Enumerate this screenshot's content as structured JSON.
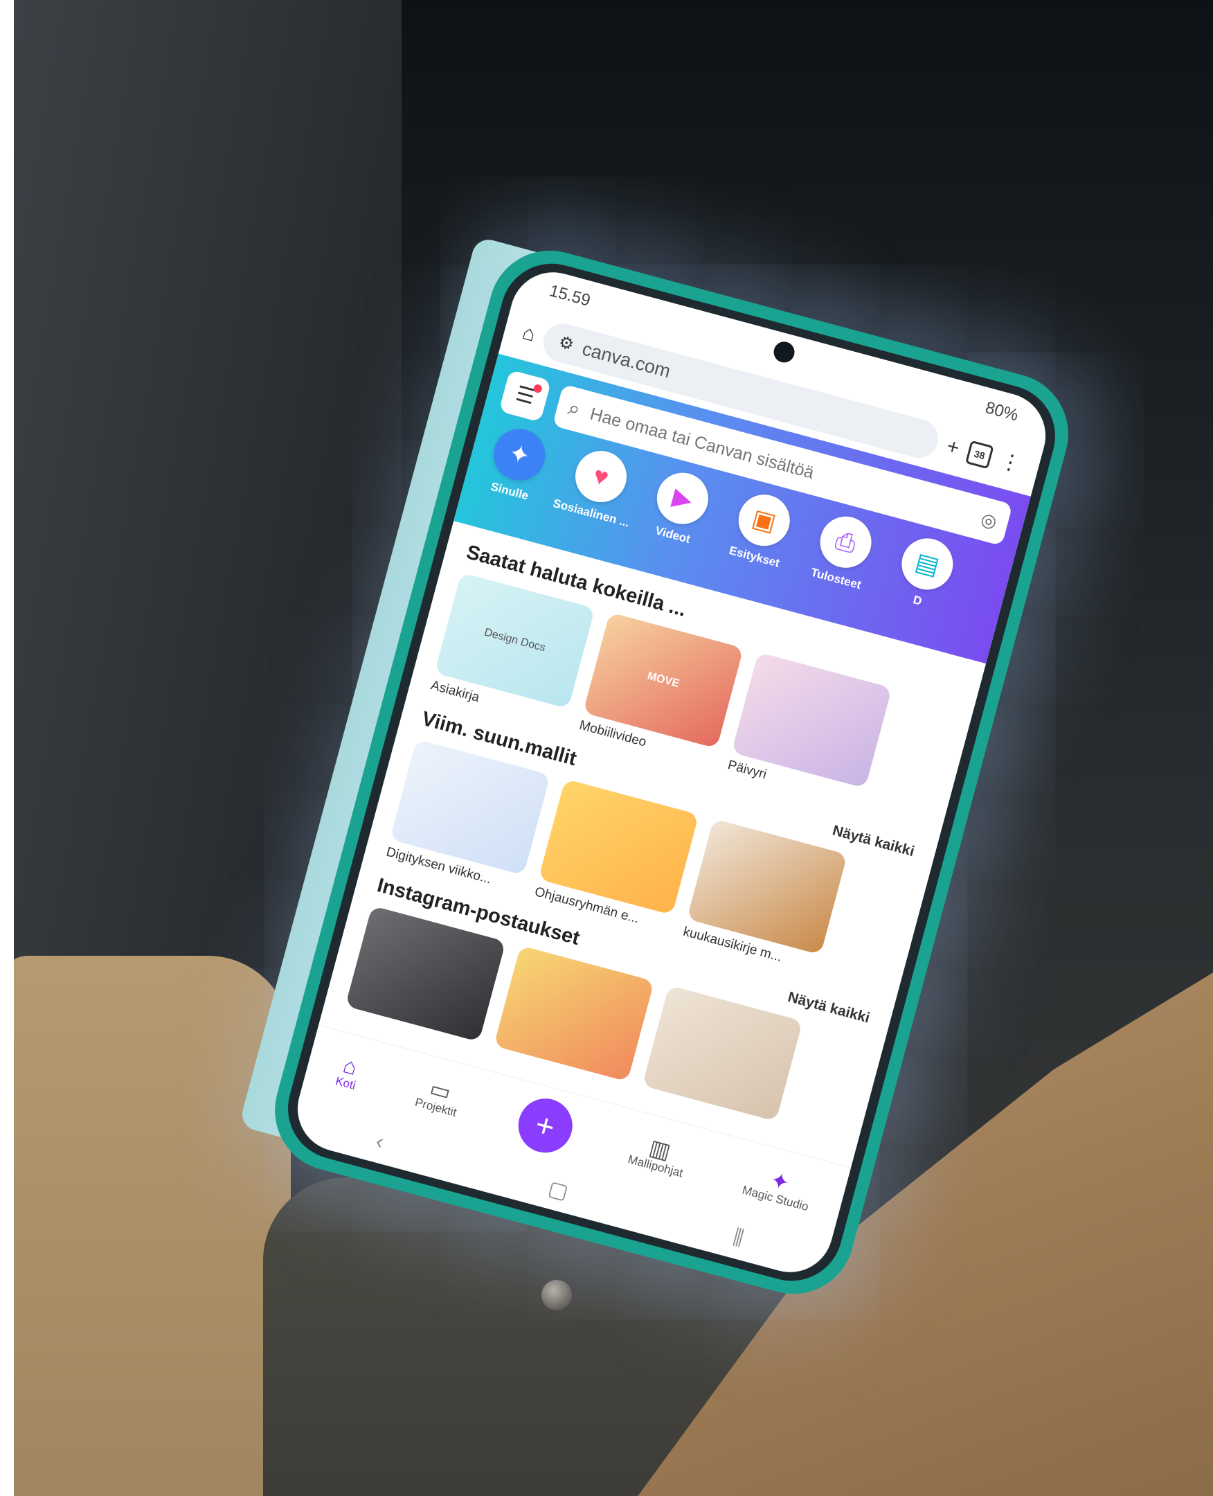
{
  "status_bar": {
    "time": "15.59",
    "battery": "80%"
  },
  "browser": {
    "url": "canva.com",
    "tab_count": "38"
  },
  "search": {
    "placeholder": "Hae omaa tai Canvan sisältöä"
  },
  "categories": [
    {
      "label": "Sinulle",
      "icon": "sparkle-icon"
    },
    {
      "label": "Sosiaalinen ...",
      "icon": "heart-chat-icon"
    },
    {
      "label": "Videot",
      "icon": "video-camera-icon"
    },
    {
      "label": "Esitykset",
      "icon": "presentation-icon"
    },
    {
      "label": "Tulosteet",
      "icon": "printer-icon"
    },
    {
      "label": "D",
      "icon": "docs-icon"
    }
  ],
  "sections": {
    "try": {
      "title": "Saatat haluta kokeilla ...",
      "items": [
        {
          "label": "Asiakirja",
          "thumb": "Design Docs"
        },
        {
          "label": "Mobiilivideo",
          "thumb": "MOVE"
        },
        {
          "label": "Päivyri",
          "thumb": ""
        }
      ]
    },
    "recent": {
      "title": "Viim. suun.mallit",
      "see_all": "Näytä kaikki",
      "items": [
        {
          "label": "Digityksen viikko..."
        },
        {
          "label": "Ohjausryhmän e..."
        },
        {
          "label": "kuukausikirje m..."
        }
      ]
    },
    "instagram": {
      "title": "Instagram-postaukset",
      "see_all": "Näytä kaikki"
    }
  },
  "bottom_nav": {
    "home": "Koti",
    "projects": "Projektit",
    "create": "+",
    "templates": "Mallipohjat",
    "magic": "Magic Studio"
  },
  "colors": {
    "brand_purple": "#8b3dff",
    "header_gradient_start": "#24c6dc",
    "header_gradient_end": "#7a4cf0",
    "phone_case": "#1aa391"
  }
}
